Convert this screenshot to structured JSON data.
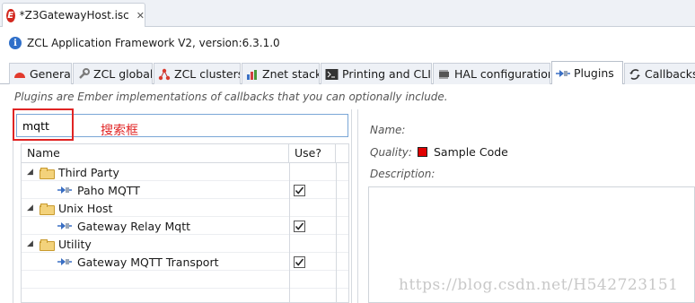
{
  "editor": {
    "tab_label": "*Z3GatewayHost.isc",
    "tab_icon": "E",
    "close_glyph": "✕"
  },
  "info": {
    "text": "ZCL Application Framework V2, version:6.3.1.0"
  },
  "tabs": [
    {
      "label": "General"
    },
    {
      "label": "ZCL global"
    },
    {
      "label": "ZCL clusters"
    },
    {
      "label": "Znet stack"
    },
    {
      "label": "Printing and CLI"
    },
    {
      "label": "HAL configuration"
    },
    {
      "label": "Plugins"
    },
    {
      "label": "Callbacks"
    }
  ],
  "active_tab": "Plugins",
  "plugins": {
    "description": "Plugins are Ember implementations of callbacks that you can optionally include.",
    "search": {
      "value": "mqtt"
    },
    "annotation": "搜索框",
    "columns": {
      "name": "Name",
      "use": "Use?"
    },
    "rows": [
      {
        "label": "Third Party",
        "type": "group"
      },
      {
        "label": "Paho MQTT",
        "type": "plugin",
        "checked": true
      },
      {
        "label": "Unix Host",
        "type": "group"
      },
      {
        "label": "Gateway Relay Mqtt",
        "type": "plugin",
        "checked": true
      },
      {
        "label": "Utility",
        "type": "group"
      },
      {
        "label": "Gateway MQTT Transport",
        "type": "plugin",
        "checked": true
      }
    ]
  },
  "details": {
    "name_label": "Name:",
    "quality_label": "Quality:",
    "quality_value": "Sample Code",
    "quality_color": "#e00000",
    "description_label": "Description:"
  },
  "watermark": "https://blog.csdn.net/H542723151",
  "colors": {
    "highlight_red": "#e02424",
    "input_border": "#7aa6d6",
    "folder": "#f3d27b"
  }
}
